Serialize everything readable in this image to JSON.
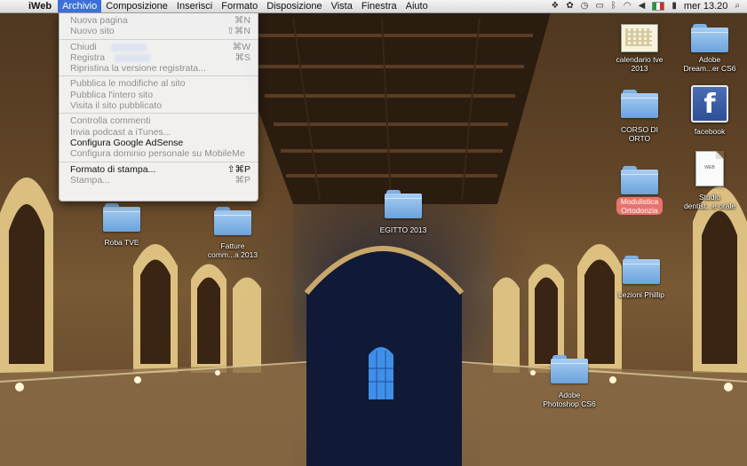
{
  "menubar": {
    "apple_glyph": "",
    "app_name": "iWeb",
    "menus": [
      "Archivio",
      "Composizione",
      "Inserisci",
      "Formato",
      "Disposizione",
      "Vista",
      "Finestra",
      "Aiuto"
    ],
    "active_menu": "Archivio",
    "clock": "mer 13.20",
    "input_flag_colors": [
      "#1f9a3a",
      "#ffffff",
      "#d32b2b"
    ]
  },
  "dropdown": {
    "items": [
      {
        "label": "Nuova pagina",
        "shortcut": "⌘N",
        "enabled": false
      },
      {
        "label": "Nuovo sito",
        "shortcut": "⇧⌘N",
        "enabled": false
      },
      {
        "separator": true
      },
      {
        "label": "Chiudi",
        "shortcut": "⌘W",
        "enabled": false
      },
      {
        "label": "Registra",
        "shortcut": "⌘S",
        "enabled": false
      },
      {
        "label": "Ripristina la versione registrata...",
        "shortcut": "",
        "enabled": false
      },
      {
        "separator": true
      },
      {
        "label": "Pubblica le modifiche al sito",
        "shortcut": "",
        "enabled": false
      },
      {
        "label": "Pubblica l'intero sito",
        "shortcut": "",
        "enabled": false
      },
      {
        "label": "Visita il sito pubblicato",
        "shortcut": "",
        "enabled": false
      },
      {
        "separator": true
      },
      {
        "label": "Controlla commenti",
        "shortcut": "",
        "enabled": false
      },
      {
        "label": "Invia podcast a iTunes...",
        "shortcut": "",
        "enabled": false
      },
      {
        "label": "Configura Google AdSense",
        "shortcut": "",
        "enabled": true
      },
      {
        "label": "Configura dominio personale su MobileMe",
        "shortcut": "",
        "enabled": false
      },
      {
        "separator": true
      },
      {
        "label": "Formato di stampa...",
        "shortcut": "⇧⌘P",
        "enabled": true
      },
      {
        "label": "Stampa...",
        "shortcut": "⌘P",
        "enabled": false
      }
    ]
  },
  "desktop": {
    "icons": [
      {
        "label": "calendario tve\n2013",
        "kind": "thumbnail"
      },
      {
        "label": "Adobe\nDream...er CS6",
        "kind": "folder"
      },
      {
        "label": "CORSO DI\nORTO",
        "kind": "folder"
      },
      {
        "label": "facebook",
        "kind": "facebook-app"
      },
      {
        "label": "Modulistica\nOrtodonzia",
        "kind": "folder",
        "tag_color": "#e8736f"
      },
      {
        "label": "Studio\ndentist...e orale",
        "kind": "document",
        "badge": "WEB"
      },
      {
        "label": "EGITTO 2013",
        "kind": "folder"
      },
      {
        "label": "Roba TVE",
        "kind": "folder"
      },
      {
        "label": "Fatture\ncomm...a 2013",
        "kind": "folder"
      },
      {
        "label": "Lezioni Phillip",
        "kind": "folder"
      },
      {
        "label": "Adobe\nPhotoshop CS6",
        "kind": "folder"
      }
    ]
  }
}
